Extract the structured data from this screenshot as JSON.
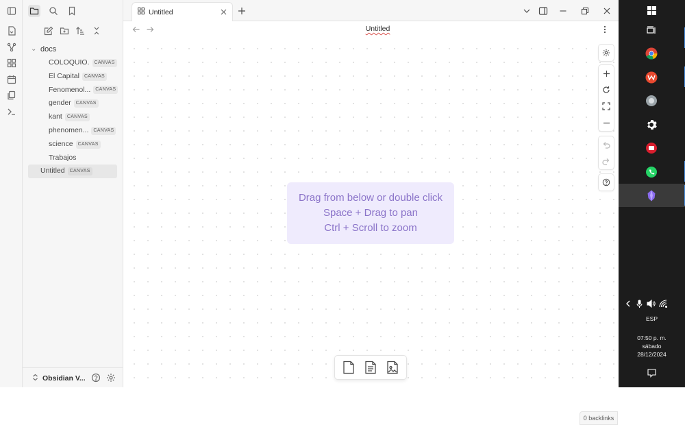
{
  "sidebar": {
    "folder": "docs",
    "items": [
      {
        "name": "COLOQUIO.",
        "tag": "CANVAS"
      },
      {
        "name": "El Capital",
        "tag": "CANVAS"
      },
      {
        "name": "Fenomenol...",
        "tag": "CANVAS"
      },
      {
        "name": "gender",
        "tag": "CANVAS"
      },
      {
        "name": "kant",
        "tag": "CANVAS"
      },
      {
        "name": "phenomen...",
        "tag": "CANVAS"
      },
      {
        "name": "science",
        "tag": "CANVAS"
      },
      {
        "name": "Trabajos",
        "tag": ""
      }
    ],
    "root_item": {
      "name": "Untitled",
      "tag": "CANVAS"
    },
    "vault_name": "Obsidian V..."
  },
  "tab": {
    "title": "Untitled"
  },
  "view": {
    "title": "Untitled"
  },
  "canvas": {
    "hint_lines": [
      "Drag from below or double click",
      "Space + Drag to pan",
      "Ctrl + Scroll to zoom"
    ]
  },
  "status": {
    "backlinks": "0 backlinks"
  },
  "taskbar": {
    "language": "ESP",
    "time": "07:50 p. m.",
    "day": "sábado",
    "date": "28/12/2024"
  },
  "colors": {
    "accent": "#8b74c9",
    "hint_bg": "#efebfd"
  }
}
